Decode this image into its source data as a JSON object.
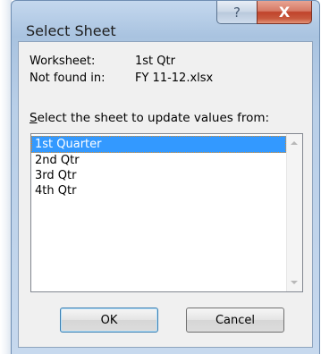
{
  "dialog": {
    "title": "Select Sheet",
    "help_glyph": "?",
    "close_glyph": "X"
  },
  "info": {
    "worksheet_label": "Worksheet:",
    "worksheet_value": "1st Qtr",
    "notfound_label": "Not found in:",
    "notfound_value": "FY 11-12.xlsx"
  },
  "prompt": {
    "accel": "S",
    "rest": "elect the sheet to update values from:"
  },
  "sheets": [
    "1st Quarter",
    "2nd Qtr",
    "3rd Qtr",
    "4th Qtr"
  ],
  "selected_index": 0,
  "buttons": {
    "ok": "OK",
    "cancel": "Cancel"
  },
  "colors": {
    "selection": "#3399ff",
    "close_button": "#c0432b"
  }
}
